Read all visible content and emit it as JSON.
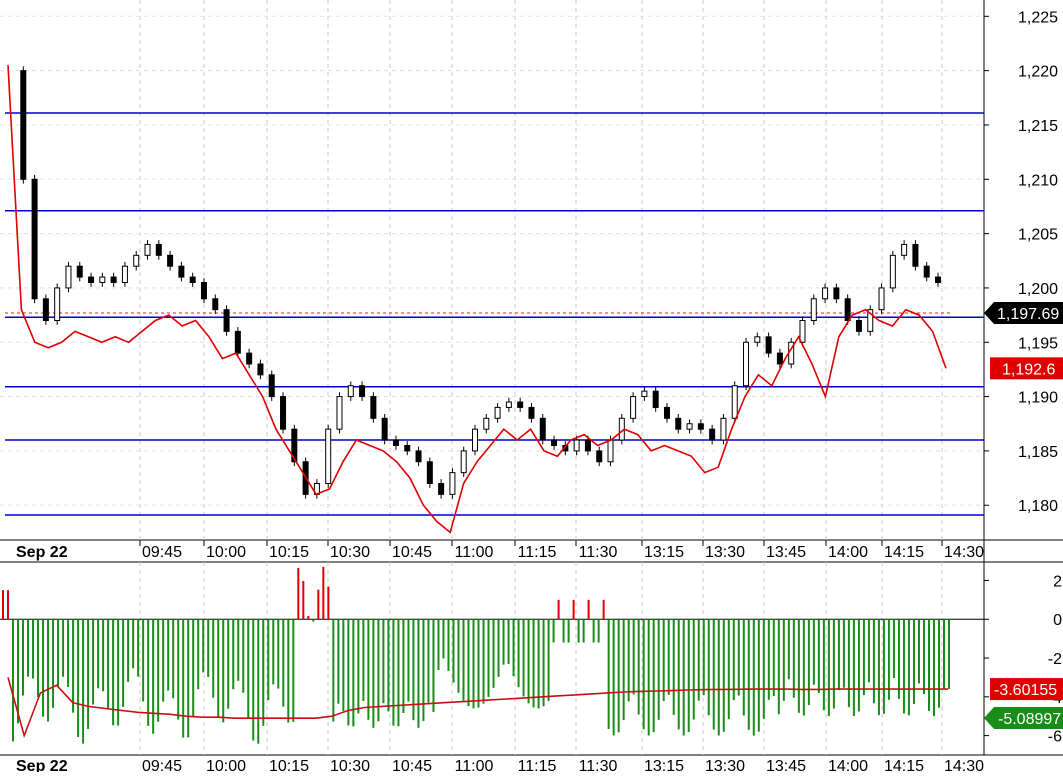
{
  "chart_data": [
    {
      "type": "candlestick",
      "title": "",
      "price_axis": {
        "ticks": [
          1180,
          1185,
          1190,
          1195,
          1200,
          1205,
          1210,
          1215,
          1220,
          1225
        ],
        "tick_labels": [
          "1,180",
          "1,185",
          "1,190",
          "1,195",
          "1,200",
          "1,205",
          "1,210",
          "1,215",
          "1,220",
          "1,225"
        ],
        "ylim": [
          1176.8,
          1226.5
        ]
      },
      "time_axis": {
        "labels": [
          "Sep 22",
          "09:45",
          "10:00",
          "10:15",
          "10:30",
          "10:45",
          "11:00",
          "11:15",
          "11:30",
          "13:15",
          "13:30",
          "13:45",
          "14:00",
          "14:15",
          "14:30"
        ]
      },
      "grid": true,
      "horizontal_lines": [
        1216.1,
        1207.1,
        1197.3,
        1190.9,
        1186.0,
        1179.1
      ],
      "current_price_label": "1,197.69",
      "current_price": 1197.69,
      "red_line_label": "1,192.6",
      "red_line_value": 1192.6,
      "price_series": [
        1220,
        1210,
        1199,
        1197,
        1200,
        1202,
        1201,
        1200.5,
        1201,
        1200.5,
        1202,
        1203,
        1204,
        1203,
        1202,
        1201,
        1200.5,
        1199,
        1198,
        1196,
        1194,
        1193,
        1192,
        1190,
        1187,
        1184,
        1181,
        1182,
        1187,
        1190,
        1191,
        1190,
        1188,
        1186,
        1185.5,
        1185,
        1184,
        1182,
        1181,
        1183,
        1185,
        1187,
        1188,
        1189,
        1189.5,
        1189,
        1188,
        1186,
        1185.5,
        1185,
        1186,
        1185,
        1184,
        1186,
        1188,
        1190,
        1190.5,
        1189,
        1188,
        1187,
        1187.5,
        1187,
        1186,
        1188,
        1191,
        1195,
        1195.5,
        1194,
        1193,
        1195,
        1197,
        1199,
        1200,
        1199,
        1197,
        1196,
        1198,
        1200,
        1203,
        1204,
        1202,
        1201,
        1200.5
      ],
      "red_series": [
        1220.5,
        1198,
        1195,
        1194.5,
        1195,
        1196,
        1195.5,
        1195,
        1195.5,
        1195,
        1196,
        1197,
        1197.5,
        1196.5,
        1197,
        1195.5,
        1193.5,
        1194,
        1192,
        1190,
        1187,
        1185,
        1183,
        1181,
        1181.5,
        1184,
        1186,
        1185.5,
        1185,
        1184,
        1182.5,
        1180,
        1178.5,
        1177.5,
        1182,
        1184,
        1185.5,
        1187,
        1186,
        1187,
        1185,
        1184.5,
        1186,
        1186.5,
        1185.5,
        1186,
        1187,
        1186.5,
        1185,
        1185.5,
        1185,
        1184.5,
        1183,
        1183.5,
        1187,
        1190,
        1192,
        1191,
        1193.5,
        1195.5,
        1193,
        1190,
        1195.5,
        1197.5,
        1198,
        1197,
        1196.5,
        1198,
        1197.5,
        1196,
        1192.6
      ]
    },
    {
      "type": "histogram",
      "title": "",
      "axis": {
        "ticks": [
          2,
          0,
          -2,
          -4,
          -6
        ],
        "tick_labels": [
          "2",
          "0",
          "-2",
          "-4",
          "-6"
        ],
        "ylim": [
          -7.0,
          2.9
        ]
      },
      "zero_line": true,
      "signal_label": "-3.60155",
      "signal_value": -3.60155,
      "histogram_label": "-5.08997",
      "histogram_value": -5.08997,
      "signal_series": [
        -3.0,
        -6.0,
        -3.8,
        -3.4,
        -4.3,
        -4.5,
        -4.6,
        -4.7,
        -4.8,
        -4.85,
        -4.9,
        -5.0,
        -5.05,
        -5.05,
        -5.1,
        -5.1,
        -5.1,
        -5.1,
        -5.1,
        -5.1,
        -5.0,
        -4.7,
        -4.55,
        -4.5,
        -4.45,
        -4.4,
        -4.35,
        -4.3,
        -4.25,
        -4.2,
        -4.15,
        -4.1,
        -4.05,
        -4.0,
        -3.95,
        -3.9,
        -3.85,
        -3.8,
        -3.75,
        -3.72,
        -3.7,
        -3.68,
        -3.65,
        -3.63,
        -3.62,
        -3.61,
        -3.6,
        -3.6,
        -3.6,
        -3.62,
        -3.62,
        -3.6,
        -3.6,
        -3.6,
        -3.6,
        -3.6,
        -3.6,
        -3.6,
        -3.6
      ]
    }
  ]
}
